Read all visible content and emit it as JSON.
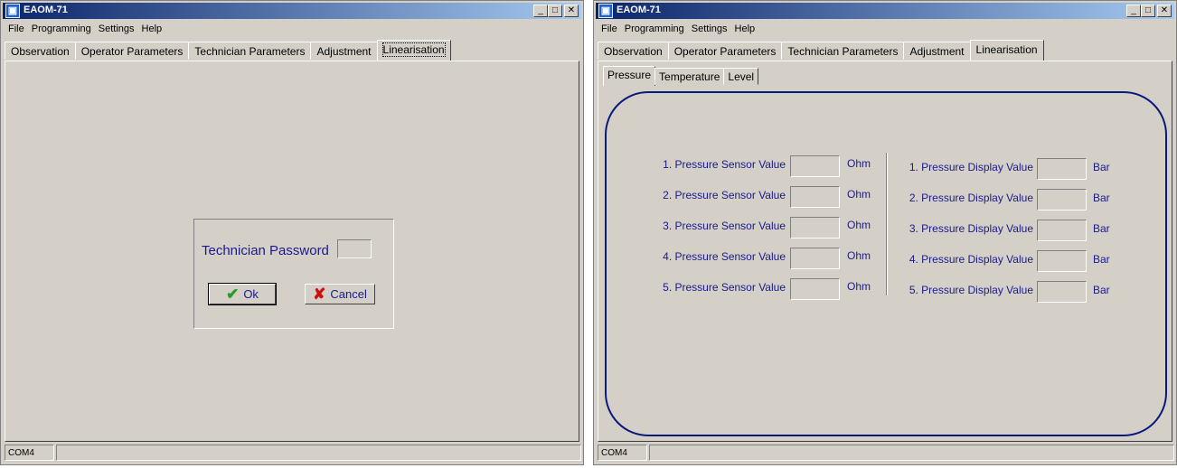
{
  "window_left": {
    "title": "EAOM-71",
    "menu": [
      "File",
      "Programming",
      "Settings",
      "Help"
    ],
    "tabs": [
      "Observation",
      "Operator Parameters",
      "Technician Parameters",
      "Adjustment",
      "Linearisation"
    ],
    "password_dialog": {
      "label": "Technician Password",
      "password_value": "",
      "ok_label": "Ok",
      "cancel_label": "Cancel"
    },
    "status": "COM4"
  },
  "window_right": {
    "title": "EAOM-71",
    "menu": [
      "File",
      "Programming",
      "Settings",
      "Help"
    ],
    "tabs": [
      "Observation",
      "Operator Parameters",
      "Technician Parameters",
      "Adjustment",
      "Linearisation"
    ],
    "sub_tabs": [
      "Pressure",
      "Temperature",
      "Level"
    ],
    "sensor_rows": [
      {
        "label": "1. Pressure Sensor Value",
        "value": "",
        "unit": "Ohm"
      },
      {
        "label": "2. Pressure Sensor Value",
        "value": "",
        "unit": "Ohm"
      },
      {
        "label": "3. Pressure Sensor Value",
        "value": "",
        "unit": "Ohm"
      },
      {
        "label": "4. Pressure Sensor Value",
        "value": "",
        "unit": "Ohm"
      },
      {
        "label": "5. Pressure Sensor Value",
        "value": "",
        "unit": "Ohm"
      }
    ],
    "display_rows": [
      {
        "label": "1. Pressure Display Value",
        "value": "",
        "unit": "Bar"
      },
      {
        "label": "2. Pressure Display Value",
        "value": "",
        "unit": "Bar"
      },
      {
        "label": "3. Pressure Display Value",
        "value": "",
        "unit": "Bar"
      },
      {
        "label": "4. Pressure Display Value",
        "value": "",
        "unit": "Bar"
      },
      {
        "label": "5. Pressure Display Value",
        "value": "",
        "unit": "Bar"
      }
    ],
    "status": "COM4"
  },
  "colors": {
    "titlebar_start": "#0a246a",
    "titlebar_end": "#a6caf0",
    "label_text": "#1a1a8c",
    "frame": "#0a1a7a",
    "ok_check": "#2a9a2a",
    "cancel_x": "#cc1010"
  }
}
